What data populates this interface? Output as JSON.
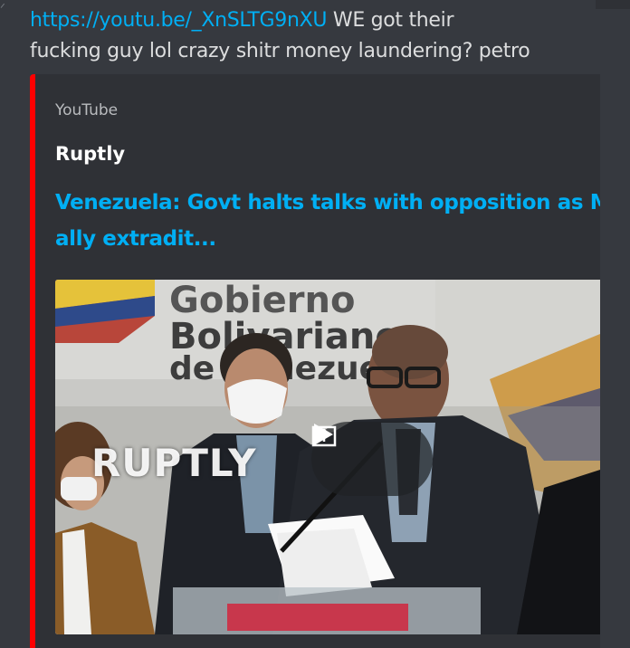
{
  "message": {
    "link_text": "https://youtu.be/_XnSLTG9nXU",
    "line1_rest": " WE got their",
    "line2": "fucking guy lol crazy shitr money laundering? petro"
  },
  "embed": {
    "accent_color": "#ff0000",
    "provider": "YouTube",
    "author": "Ruptly",
    "title_line1": "Venezuela: Govt halts talks with opposition as Mad",
    "title_line2": "ally extradit...",
    "video": {
      "watermark": "RUPTLY",
      "backdrop_text_line1": "Gobierno",
      "backdrop_text_line2": "Bolivariano",
      "backdrop_text_line3": "de Venezuela",
      "play_icon": "play-icon",
      "open_icon": "open-external-icon"
    }
  },
  "colors": {
    "background": "#36393f",
    "embed_background": "#2f3136",
    "link": "#00aff4",
    "text": "#dcddde"
  }
}
